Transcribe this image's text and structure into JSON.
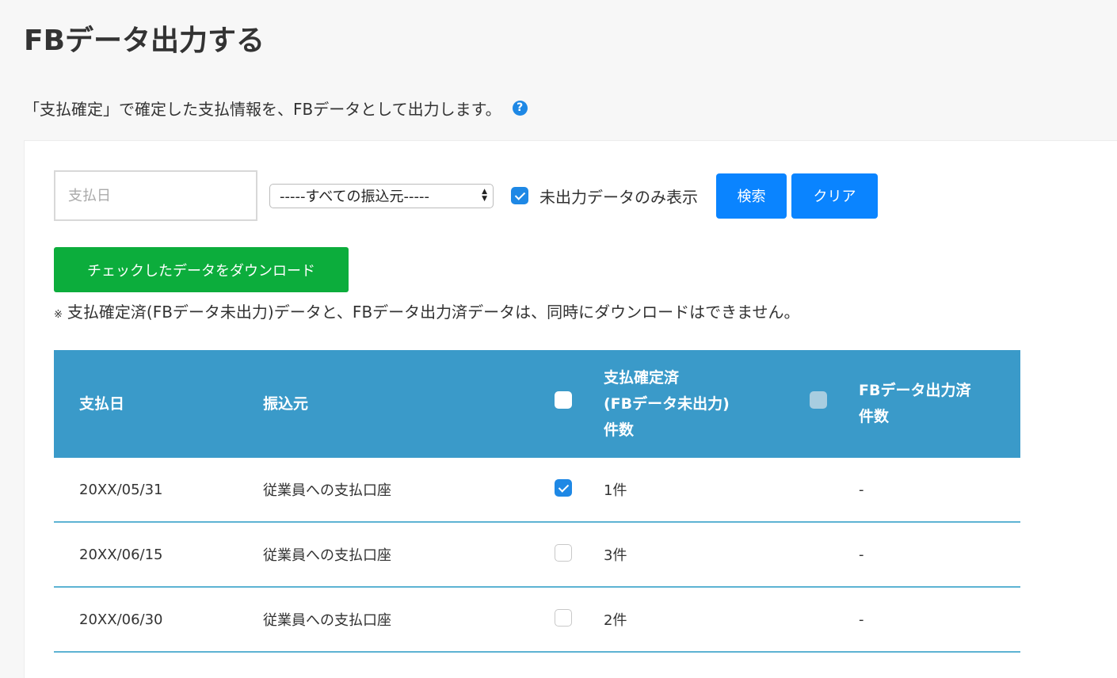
{
  "page": {
    "title": "FBデータ出力する",
    "description": "「支払確定」で確定した支払情報を、FBデータとして出力します。",
    "help_icon": "question-circle-icon"
  },
  "filters": {
    "date_placeholder": "支払日",
    "source_select_value": "-----すべての振込元-----",
    "unoutput_only_label": "未出力データのみ表示",
    "unoutput_only_checked": true,
    "search_label": "検索",
    "clear_label": "クリア"
  },
  "download": {
    "button_label": "チェックしたデータをダウンロード",
    "note_mark": "※",
    "note_text": "支払確定済(FBデータ未出力)データと、FBデータ出力済データは、同時にダウンロードはできません。"
  },
  "table": {
    "headers": {
      "date": "支払日",
      "source": "振込元",
      "unoutput_line1": "支払確定済",
      "unoutput_line2": "(FBデータ未出力)",
      "unoutput_line3": "件数",
      "output_line1": "FBデータ出力済",
      "output_line2": "件数"
    },
    "rows": [
      {
        "date": "20XX/05/31",
        "source": "従業員への支払口座",
        "checked": true,
        "unoutput_count": "1件",
        "output_count": "-"
      },
      {
        "date": "20XX/06/15",
        "source": "従業員への支払口座",
        "checked": false,
        "unoutput_count": "3件",
        "output_count": "-"
      },
      {
        "date": "20XX/06/30",
        "source": "従業員への支払口座",
        "checked": false,
        "unoutput_count": "2件",
        "output_count": "-"
      }
    ]
  },
  "colors": {
    "accent_blue": "#0a84ff",
    "download_green": "#0cad3c",
    "table_header": "#3a9ac9",
    "row_divider": "#5db3d3"
  }
}
